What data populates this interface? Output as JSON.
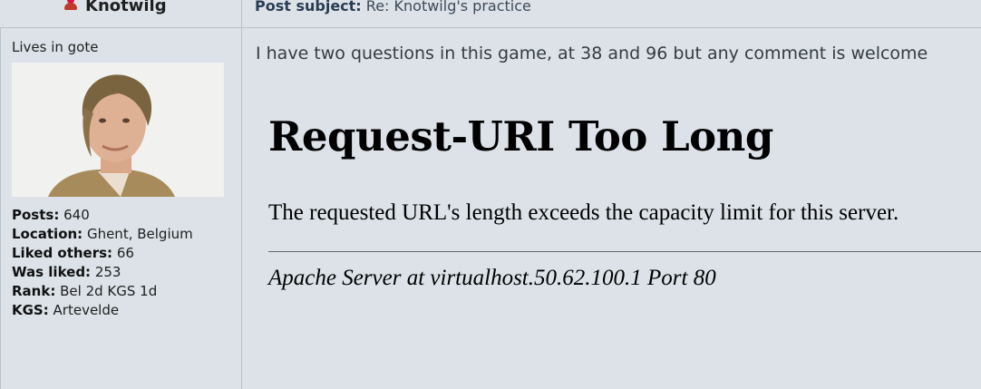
{
  "author": {
    "name": "Knotwilg",
    "rank_title": "Lives in gote"
  },
  "post": {
    "subject_label": "Post subject:",
    "subject": "Re: Knotwilg's practice",
    "intro": "I have two questions in this game, at 38 and 96 but any comment is welcome"
  },
  "profile": [
    {
      "label": "Posts:",
      "value": "640"
    },
    {
      "label": "Location:",
      "value": "Ghent, Belgium"
    },
    {
      "label": "Liked others:",
      "value": "66"
    },
    {
      "label": "Was liked:",
      "value": "253"
    },
    {
      "label": "Rank:",
      "value": "Bel 2d KGS 1d"
    },
    {
      "label": "KGS:",
      "value": "Artevelde"
    }
  ],
  "error": {
    "title": "Request-URI Too Long",
    "message": "The requested URL's length exceeds the capacity limit for this server.",
    "address": "Apache Server at virtualhost.50.62.100.1 Port 80"
  },
  "colors": {
    "background": "#dce2e7",
    "border": "#b9c3cc",
    "online": "#c0392b"
  },
  "icons": {
    "online": "user-online-icon"
  }
}
